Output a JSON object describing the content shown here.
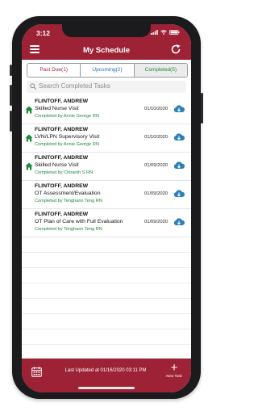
{
  "status_bar": {
    "time": "3:12"
  },
  "header": {
    "title": "My Schedule"
  },
  "tabs": [
    {
      "label": "Past Due(1)"
    },
    {
      "label": "Upcoming(2)"
    },
    {
      "label": "Completed(5)"
    }
  ],
  "search": {
    "placeholder": "Search Completed Tasks"
  },
  "tasks": [
    {
      "patient": "FLINTOFF, ANDREW",
      "visit": "Skilled Nurse Visit",
      "completed_by": "Completed by Annie George RN",
      "date": "01/10/2020",
      "home_icon": true
    },
    {
      "patient": "FLINTOFF, ANDREW",
      "visit": "LVN/LPN Supervisory Visit",
      "completed_by": "Completed by Annie George RN",
      "date": "01/10/2020",
      "home_icon": true
    },
    {
      "patient": "FLINTOFF, ANDREW",
      "visit": "Skilled Nurse Visit",
      "completed_by": "Completed by Chiranth S RN",
      "date": "01/09/2020",
      "home_icon": true
    },
    {
      "patient": "FLINTOFF, ANDREW",
      "visit": "OT Assessment/Evaluation",
      "completed_by": "Completed by Tenghann Teng RN",
      "date": "01/09/2020",
      "home_icon": false
    },
    {
      "patient": "FLINTOFF, ANDREW",
      "visit": "OT Plan of Care with Full Evaluation",
      "completed_by": "Completed by Tenghann Teng RN",
      "date": "01/09/2020",
      "home_icon": false
    }
  ],
  "footer": {
    "last_updated": "Last Updated at 01/16/2020 03:11 PM",
    "new_task_label": "New Task"
  },
  "colors": {
    "brand": "#9e2236",
    "completed_text": "#1b8a3a",
    "cloud_icon": "#2b7fb8"
  },
  "icons": [
    "menu-icon",
    "refresh-icon",
    "search-icon",
    "home-icon",
    "cloud-download-icon",
    "calendar-icon",
    "plus-icon"
  ]
}
